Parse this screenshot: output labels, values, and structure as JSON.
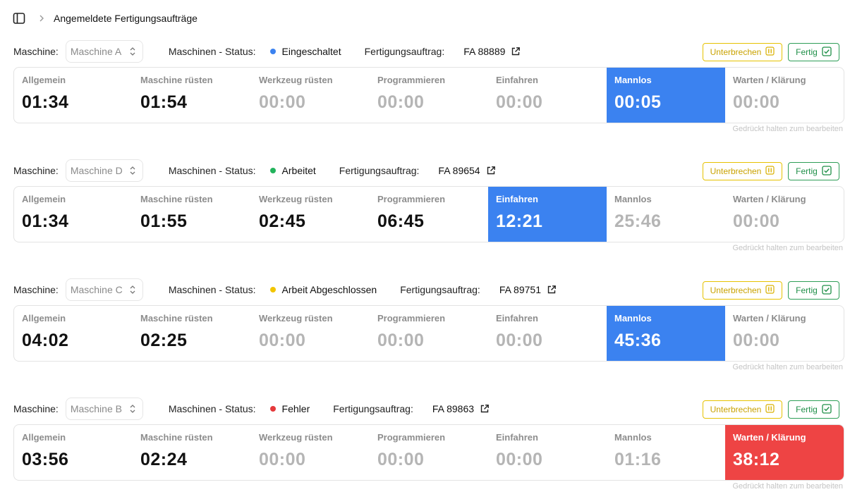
{
  "breadcrumb": {
    "title": "Angemeldete Fertigungsaufträge"
  },
  "labels": {
    "machine": "Maschine:",
    "status": "Maschinen - Status:",
    "order": "Fertigungsauftrag:",
    "interrupt": "Unterbrechen",
    "done": "Fertig",
    "hint": "Gedrückt halten zum bearbeiten"
  },
  "phases": [
    "Allgemein",
    "Maschine rüsten",
    "Werkzeug rüsten",
    "Programmieren",
    "Einfahren",
    "Mannlos",
    "Warten / Klärung"
  ],
  "colors": {
    "blue": "#3b82f0",
    "red": "#ee4444",
    "yellow": "#e6c200",
    "green": "#2e9e57"
  },
  "machines": [
    {
      "machine": "Maschine A",
      "status": "Eingeschaltet",
      "status_color": "#3b82f0",
      "order": "FA 88889",
      "times": [
        "01:34",
        "01:54",
        "00:00",
        "00:00",
        "00:00",
        "00:05",
        "00:00"
      ],
      "active": 5,
      "active_color": "blue"
    },
    {
      "machine": "Maschine D",
      "status": "Arbeitet",
      "status_color": "#22b35c",
      "order": "FA 89654",
      "times": [
        "01:34",
        "01:55",
        "02:45",
        "06:45",
        "12:21",
        "25:46",
        "00:00"
      ],
      "active": 4,
      "active_color": "blue"
    },
    {
      "machine": "Maschine C",
      "status": "Arbeit Abgeschlossen",
      "status_color": "#f2c500",
      "order": "FA 89751",
      "times": [
        "04:02",
        "02:25",
        "00:00",
        "00:00",
        "00:00",
        "45:36",
        "00:00"
      ],
      "active": 5,
      "active_color": "blue"
    },
    {
      "machine": "Maschine B",
      "status": "Fehler",
      "status_color": "#e5393b",
      "order": "FA 89863",
      "times": [
        "03:56",
        "02:24",
        "00:00",
        "00:00",
        "00:00",
        "01:16",
        "38:12"
      ],
      "active": 6,
      "active_color": "red"
    }
  ]
}
